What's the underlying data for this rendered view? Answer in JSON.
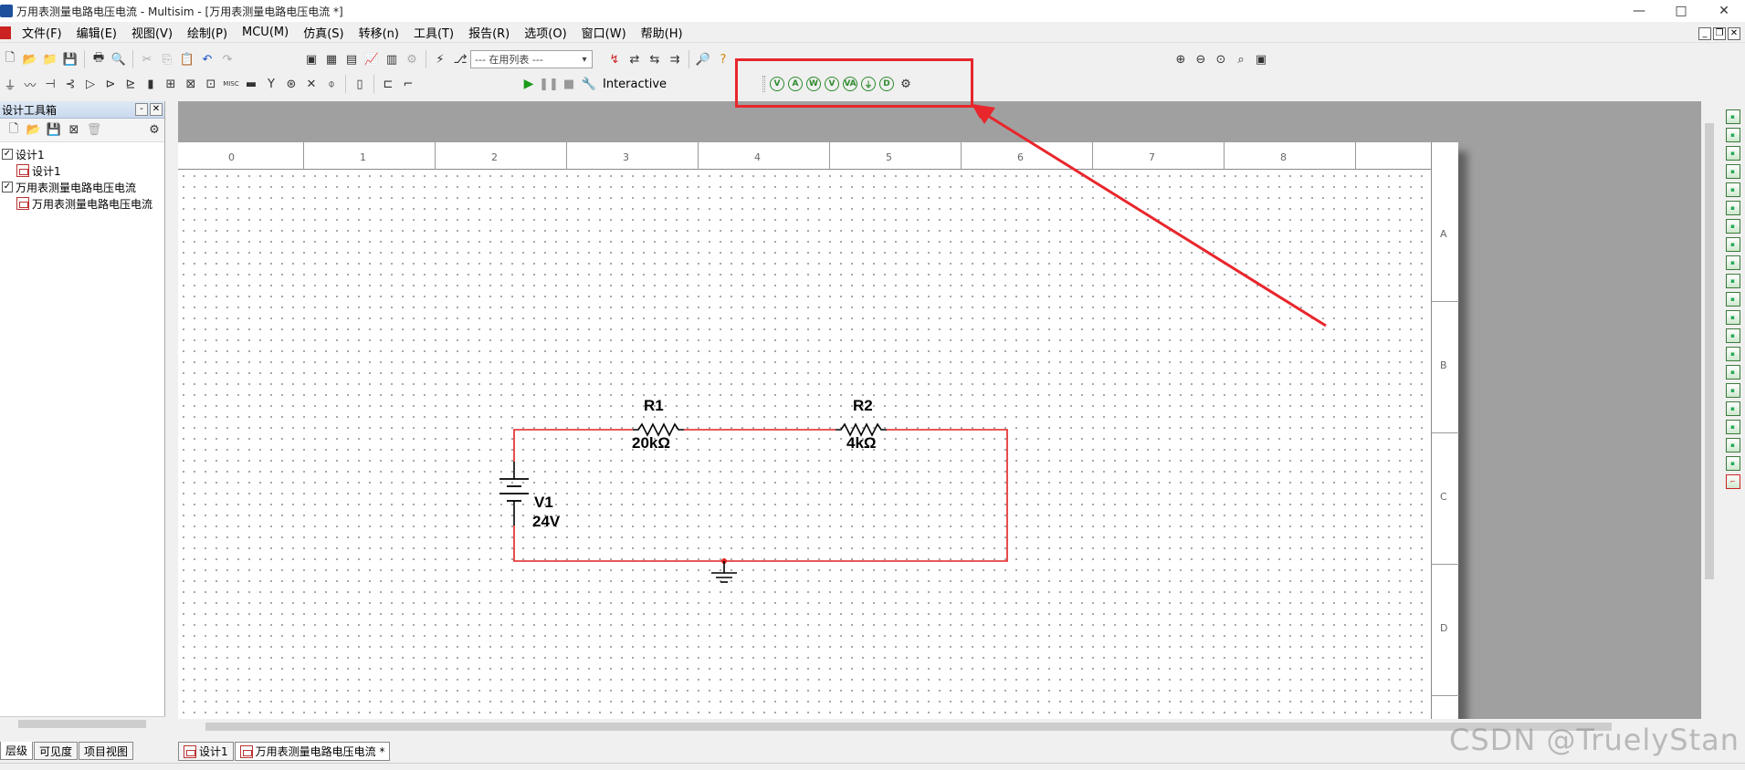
{
  "window": {
    "title": "万用表测量电路电压电流 - Multisim - [万用表测量电路电压电流 *]",
    "controls": {
      "minimize": "—",
      "maximize": "□",
      "close": "✕"
    }
  },
  "menu": {
    "items": [
      "文件(F)",
      "编辑(E)",
      "视图(V)",
      "绘制(P)",
      "MCU(M)",
      "仿真(S)",
      "转移(n)",
      "工具(T)",
      "报告(R)",
      "选项(O)",
      "窗口(W)",
      "帮助(H)"
    ],
    "mdi_controls": [
      "_",
      "❐",
      "✕"
    ]
  },
  "toolbar": {
    "inuse_list": "--- 在用列表 ---",
    "interactive": "Interactive"
  },
  "toolbox": {
    "title": "设计工具箱",
    "tree": [
      {
        "label": "设计1",
        "level": 0,
        "checked": true
      },
      {
        "label": "设计1",
        "level": 1,
        "checked": false
      },
      {
        "label": "万用表测量电路电压电流",
        "level": 0,
        "checked": true
      },
      {
        "label": "万用表测量电路电压电流",
        "level": 1,
        "checked": false
      }
    ],
    "bottom_tabs": [
      "层级",
      "可见度",
      "项目视图"
    ]
  },
  "ruler": {
    "columns": [
      "0",
      "1",
      "2",
      "3",
      "4",
      "5",
      "6",
      "7",
      "8"
    ],
    "rows": [
      "A",
      "B",
      "C",
      "D"
    ]
  },
  "circuit": {
    "r1_name": "R1",
    "r1_value": "20kΩ",
    "r2_name": "R2",
    "r2_value": "4kΩ",
    "v1_name": "V1",
    "v1_value": "24V",
    "wire_color": "#e32020"
  },
  "doc_tabs": [
    "设计1",
    "万用表测量电路电压电流 *"
  ],
  "watermark": "CSDN @TruelyStan",
  "annotation": {
    "color": "#e8262c"
  }
}
